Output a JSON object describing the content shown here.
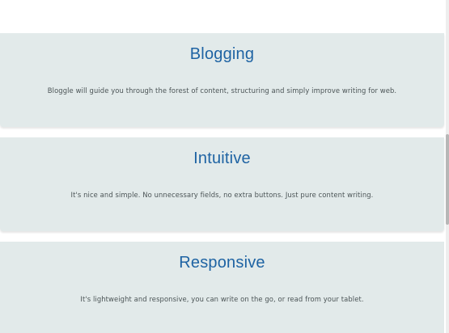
{
  "features": [
    {
      "title": "Blogging",
      "text": "Bloggle will guide you through the forest of content, structuring and simply improve writing for web."
    },
    {
      "title": "Intuitive",
      "text": "It's nice and simple. No unnecessary fields, no extra buttons. Just pure content writing."
    },
    {
      "title": "Responsive",
      "text": "It's lightweight and responsive, you can write on the go, or read from your tablet."
    }
  ],
  "colors": {
    "card_background": "#e2eaea",
    "title": "#1e63a3",
    "text": "#4b5456"
  }
}
